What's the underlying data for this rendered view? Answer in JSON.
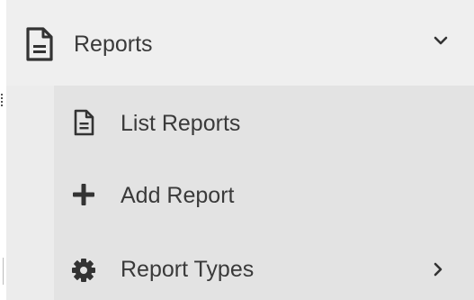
{
  "menu": {
    "parent": {
      "label": "Reports",
      "icon": "file-text-icon",
      "expanded": true
    },
    "items": [
      {
        "label": "List Reports",
        "icon": "file-text-icon"
      },
      {
        "label": "Add Report",
        "icon": "plus-icon"
      },
      {
        "label": "Report Types",
        "icon": "gear-icon",
        "has_submenu": true
      }
    ]
  },
  "colors": {
    "parent_bg": "#efefef",
    "submenu_bg": "#e3e3e3",
    "text": "#3a3a3a",
    "icon": "#333333"
  }
}
